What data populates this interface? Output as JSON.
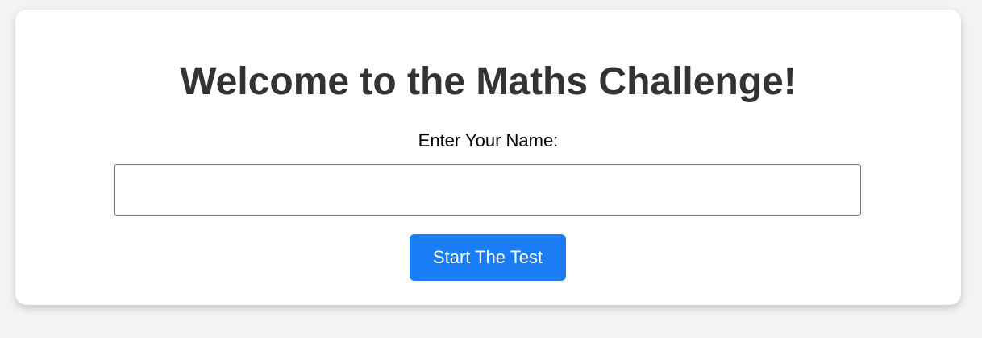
{
  "card": {
    "title": "Welcome to the Maths Challenge!",
    "name_label": "Enter Your Name:",
    "name_input": {
      "value": "",
      "placeholder": ""
    },
    "start_button_label": "Start The Test"
  },
  "colors": {
    "page_background": "#f3f3f3",
    "card_background": "#ffffff",
    "title_text": "#333333",
    "button_background": "#1a7df5",
    "button_text": "#ffffff"
  }
}
